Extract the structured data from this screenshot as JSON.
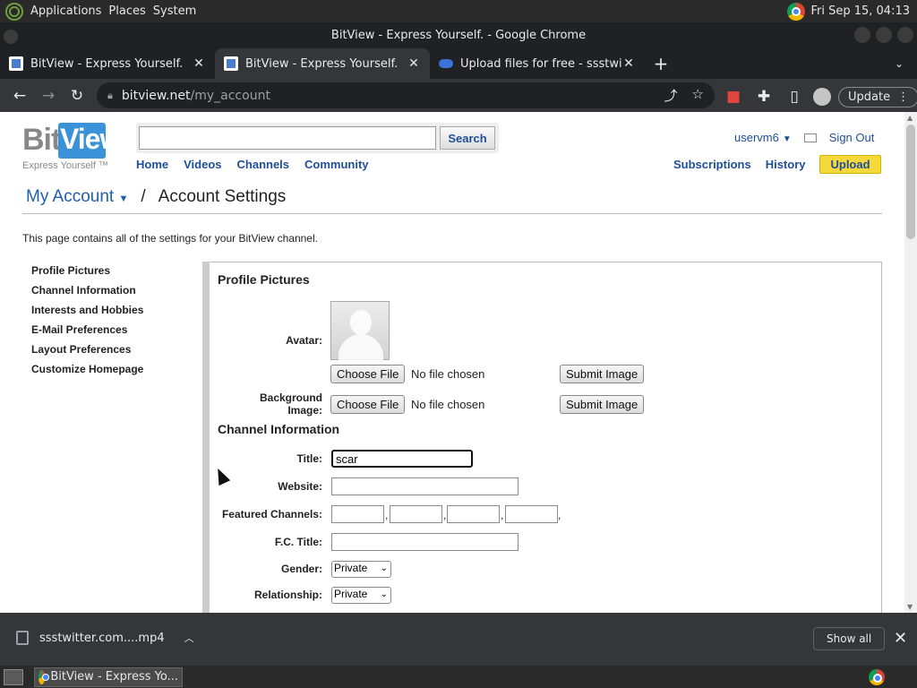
{
  "desktop_panel": {
    "menus": [
      "Applications",
      "Places",
      "System"
    ],
    "clock": "Fri Sep 15, 04:13"
  },
  "window": {
    "title": "BitView - Express Yourself. - Google Chrome"
  },
  "tabs": [
    {
      "title": "BitView - Express Yourself.",
      "active": false
    },
    {
      "title": "BitView - Express Yourself.",
      "active": true
    },
    {
      "title": "Upload files for free - ssstwitter",
      "active": false
    }
  ],
  "address_bar": {
    "host": "bitview.net",
    "path": "/my_account"
  },
  "toolbar": {
    "update_label": "Update"
  },
  "site": {
    "logo_bit": "Bit",
    "logo_view": "View",
    "logo_tagline": "Express Yourself ™",
    "search": {
      "value": "",
      "button_label": "Search"
    },
    "nav": [
      "Home",
      "Videos",
      "Channels",
      "Community"
    ],
    "username": "uservm6",
    "sign_out": "Sign Out",
    "right_nav": {
      "subscriptions": "Subscriptions",
      "history": "History",
      "upload": "Upload"
    }
  },
  "breadcrumb": {
    "account": "My Account",
    "separator": "/",
    "current": "Account Settings"
  },
  "intro_text": "This page contains all of the settings for your BitView channel.",
  "sidebar": [
    "Profile Pictures",
    "Channel Information",
    "Interests and Hobbies",
    "E-Mail Preferences",
    "Layout Preferences",
    "Customize Homepage"
  ],
  "profile_pictures": {
    "heading": "Profile Pictures",
    "avatar_label": "Avatar:",
    "background_label_line1": "Background",
    "background_label_line2": "Image:",
    "choose_file_label": "Choose File",
    "no_file_text": "No file chosen",
    "submit_label": "Submit Image"
  },
  "channel_information": {
    "heading": "Channel Information",
    "title_label": "Title:",
    "title_value": "scar",
    "website_label": "Website:",
    "website_value": "",
    "featured_label": "Featured Channels:",
    "featured_separator": ",",
    "fc_title_label": "F.C. Title:",
    "fc_title_value": "",
    "gender_label": "Gender:",
    "gender_value": "Private",
    "relationship_label": "Relationship:",
    "relationship_value": "Private"
  },
  "downloads": {
    "file_name": "ssstwitter.com....mp4",
    "show_all": "Show all"
  },
  "taskbar": {
    "task_title": "BitView - Express Yo..."
  }
}
